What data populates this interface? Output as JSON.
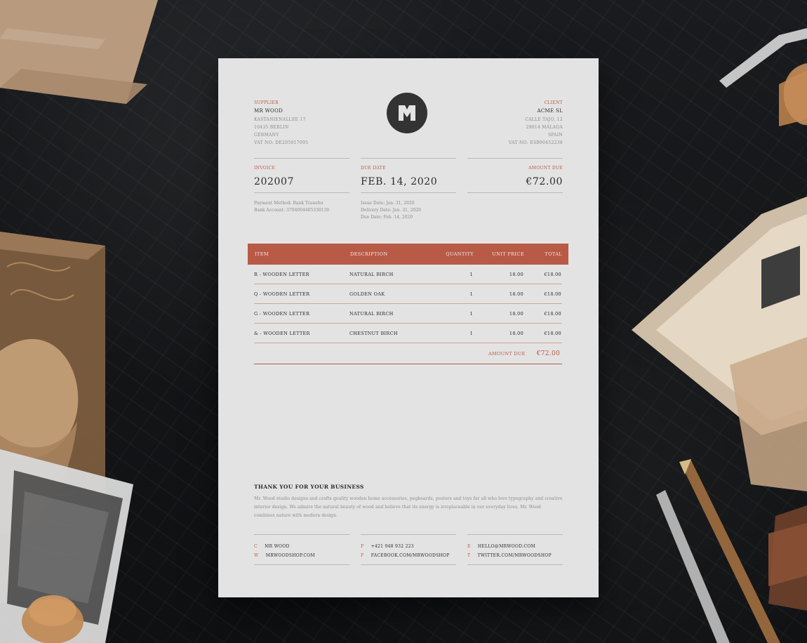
{
  "invoice": {
    "supplier": {
      "label": "SUPPLIER",
      "name": "MR WOOD",
      "lines": [
        "KASTANIENALLEE 17",
        "10435 BERLIN",
        "GERMANY",
        "VAT NO: DE205017095"
      ]
    },
    "client": {
      "label": "CLIENT",
      "name": "ACME SL",
      "lines": [
        "CALLE TAJO, 12",
        "29014 MÁLAGA",
        "SPAIN",
        "VAT NO: ESB90452238"
      ]
    },
    "meta": {
      "invoice_label": "INVOICE",
      "invoice_value": "202007",
      "due_label": "DUE DATE",
      "due_value": "FEB. 14, 2020",
      "amount_label": "AMOUNT DUE",
      "amount_value": "€72.00"
    },
    "details": {
      "left": [
        "Payment Method: Bank Transfer",
        "Bank Account: 3704004405330130"
      ],
      "middle": [
        "Issue Date: Jan. 31, 2020",
        "Delivery Date: Jan. 31, 2020",
        "Due Date: Feb. 14, 2020"
      ]
    },
    "table": {
      "headers": {
        "item": "ITEM",
        "description": "DESCRIPTION",
        "quantity": "QUANTITY",
        "unit_price": "UNIT PRICE",
        "total": "TOTAL"
      },
      "rows": [
        {
          "item": "R - WOODEN LETTER",
          "description": "NATURAL BIRCH",
          "quantity": "1",
          "unit_price": "18.00",
          "total": "€18.00"
        },
        {
          "item": "Q - WOODEN LETTER",
          "description": "GOLDEN OAK",
          "quantity": "1",
          "unit_price": "18.00",
          "total": "€18.00"
        },
        {
          "item": "G - WOODEN LETTER",
          "description": "NATURAL BIRCH",
          "quantity": "1",
          "unit_price": "18.00",
          "total": "€18.00"
        },
        {
          "item": "& - WOODEN LETTER",
          "description": "CHESTNUT BIRCH",
          "quantity": "1",
          "unit_price": "18.00",
          "total": "€18.00"
        }
      ],
      "amount_due_label": "AMOUNT DUE",
      "amount_due_value": "€72.00"
    },
    "thanks": {
      "title": "THANK YOU FOR YOUR BUSINESS",
      "body": "Mr. Wood studio designs and crafts quality wooden home accessories, pegboards, posters and toys for all who love typography and creative interior design. We admire the natural beauty of wood and believe that its energy is irreplaceable in our everyday lives. Mr. Wood combines nature with modern design."
    },
    "contact": {
      "c_letter": "C",
      "c_value": "MR WOOD",
      "w_letter": "W",
      "w_value": "MRWOODSHOP.COM",
      "p_letter": "P",
      "p_value": "+421 948 932 223",
      "f_letter": "F",
      "f_value": "FACEBOOK.COM/MRWOODSHOP",
      "e_letter": "E",
      "e_value": "HELLO@MRWOOD.COM",
      "t_letter": "T",
      "t_value": "TWITTER.COM/MRWOODSHOP"
    }
  },
  "style": {
    "accent": "#b85a46",
    "paper": "#e3e3e3",
    "logo_bg": "#333334"
  }
}
